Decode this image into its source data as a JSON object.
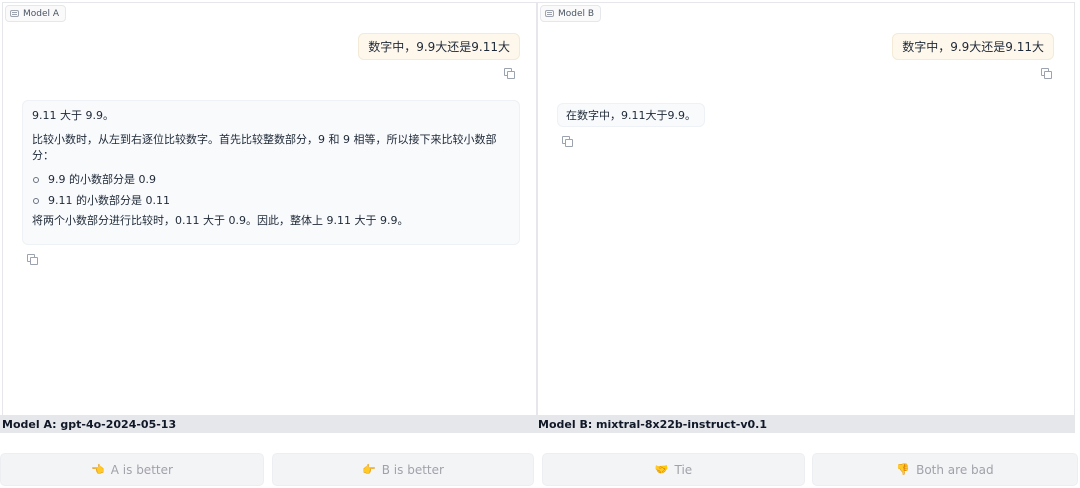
{
  "panel_a": {
    "chip_label": "Model A",
    "user_message": "数字中，9.9大还是9.11大",
    "response": {
      "line1": "9.11 大于 9.9。",
      "para1_line1": "比较小数时，从左到右逐位比较数字。首先比较整数部分，9 和 9 相等，所以接下来比较小数部",
      "para1_line2": "分：",
      "bullets": [
        "9.9 的小数部分是 0.9",
        "9.11 的小数部分是 0.11"
      ],
      "conclusion": "将两个小数部分进行比较时，0.11 大于 0.9。因此，整体上 9.11 大于 9.9。"
    },
    "model_label": "Model A: gpt-4o-2024-05-13"
  },
  "panel_b": {
    "chip_label": "Model B",
    "user_message": "数字中，9.9大还是9.11大",
    "response": "在数字中，9.11大于9.9。",
    "model_label": "Model B: mixtral-8x22b-instruct-v0.1"
  },
  "vote_buttons": {
    "a_better": {
      "emoji": "👈",
      "label": "A is better"
    },
    "b_better": {
      "emoji": "👉",
      "label": "B is better"
    },
    "tie": {
      "emoji": "🤝",
      "label": "Tie"
    },
    "both_bad": {
      "emoji": "👎",
      "label": "Both are bad"
    }
  }
}
